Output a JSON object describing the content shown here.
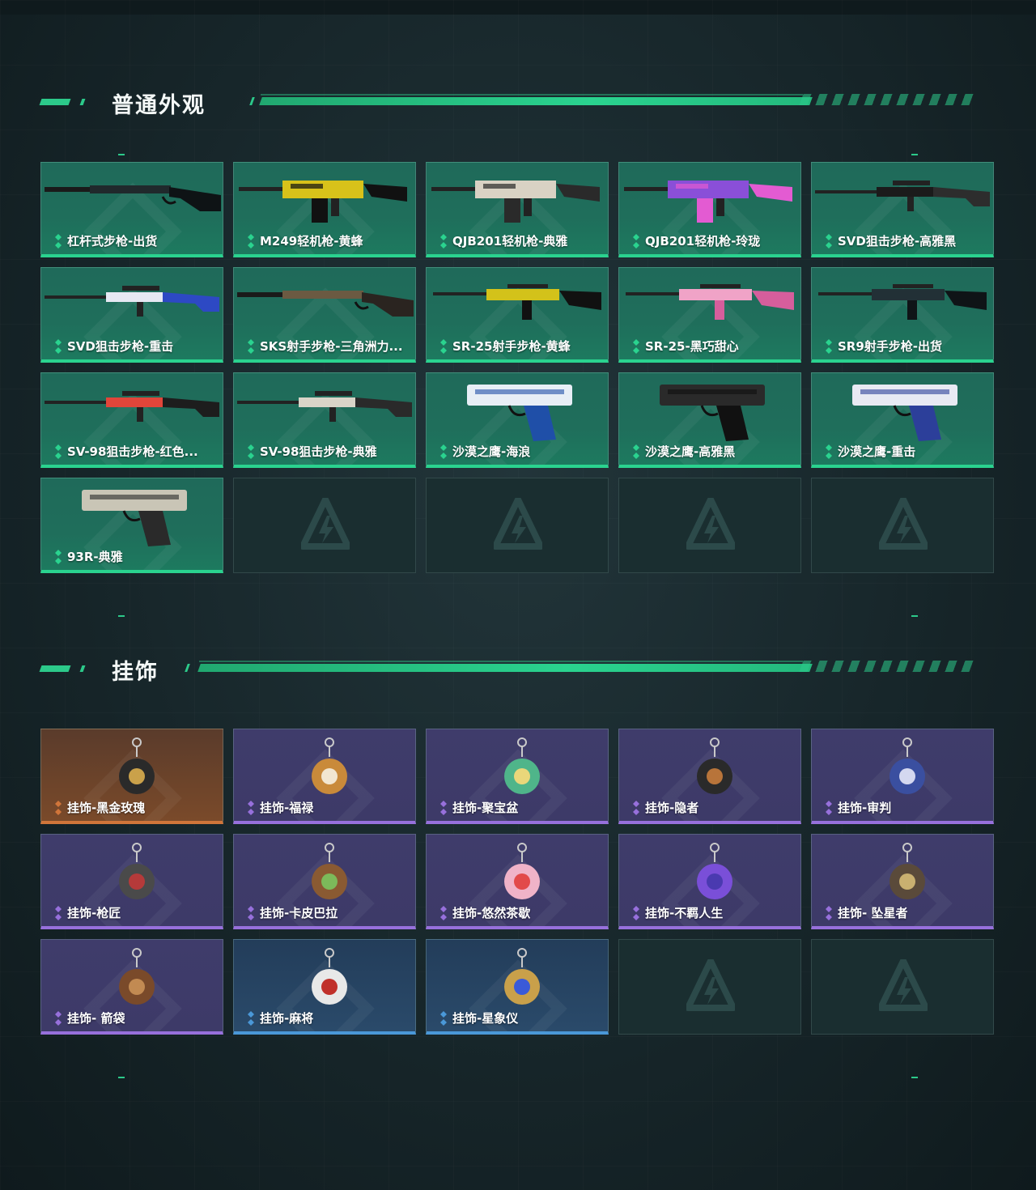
{
  "sections": [
    {
      "title": "普通外观",
      "items": [
        {
          "label": "杠杆式步枪-出货",
          "type": "rifle",
          "palette": [
            "#20292c",
            "#0e1315"
          ]
        },
        {
          "label": "M249轻机枪-黄蜂",
          "type": "lmg",
          "palette": [
            "#d8c21a",
            "#111111"
          ]
        },
        {
          "label": "QJB201轻机枪-典雅",
          "type": "lmg",
          "palette": [
            "#d9d2c4",
            "#2a2a2a"
          ]
        },
        {
          "label": "QJB201轻机枪-玲珑",
          "type": "lmg",
          "palette": [
            "#8a4fd8",
            "#e35bd2"
          ]
        },
        {
          "label": "SVD狙击步枪-高雅黑",
          "type": "sniper",
          "palette": [
            "#1b1b1b",
            "#2d2d2d"
          ]
        },
        {
          "label": "SVD狙击步枪-重击",
          "type": "sniper",
          "palette": [
            "#e6e8f3",
            "#2d49c4"
          ]
        },
        {
          "label": "SKS射手步枪-三角洲力...",
          "type": "rifle",
          "palette": [
            "#6b5a42",
            "#2a2420"
          ]
        },
        {
          "label": "SR-25射手步枪-黄蜂",
          "type": "dmr",
          "palette": [
            "#d3c21a",
            "#111111"
          ]
        },
        {
          "label": "SR-25-黑巧甜心",
          "type": "dmr",
          "palette": [
            "#f0a3c7",
            "#d65e9c"
          ]
        },
        {
          "label": "SR9射手步枪-出货",
          "type": "dmr",
          "palette": [
            "#223036",
            "#0f1417"
          ]
        },
        {
          "label": "SV-98狙击步枪-红色...",
          "type": "sniper",
          "palette": [
            "#e1453a",
            "#1d1d1d"
          ]
        },
        {
          "label": "SV-98狙击步枪-典雅",
          "type": "sniper",
          "palette": [
            "#d9d4c8",
            "#2a2a2a"
          ]
        },
        {
          "label": "沙漠之鹰-海浪",
          "type": "pistol",
          "palette": [
            "#e7eef6",
            "#1f4fa8"
          ]
        },
        {
          "label": "沙漠之鹰-高雅黑",
          "type": "pistol",
          "palette": [
            "#2a2a2a",
            "#111111"
          ]
        },
        {
          "label": "沙漠之鹰-重击",
          "type": "pistol",
          "palette": [
            "#e8eaf3",
            "#2c3f9a"
          ]
        },
        {
          "label": "93R-典雅",
          "type": "pistol",
          "palette": [
            "#c9c5b6",
            "#2a2a2a"
          ]
        }
      ]
    },
    {
      "title": "挂饰",
      "items": [
        {
          "label": "挂饰-黑金玫瑰",
          "rarity": "orange",
          "palette": [
            "#2a2a2a",
            "#caa14a"
          ]
        },
        {
          "label": "挂饰-福禄",
          "rarity": "purple",
          "palette": [
            "#c98a3a",
            "#f2e6d0"
          ]
        },
        {
          "label": "挂饰-聚宝盆",
          "rarity": "purple",
          "palette": [
            "#4fb58a",
            "#e9d77a"
          ]
        },
        {
          "label": "挂饰-隐者",
          "rarity": "purple",
          "palette": [
            "#2a2a2a",
            "#b8743a"
          ]
        },
        {
          "label": "挂饰-审判",
          "rarity": "purple",
          "palette": [
            "#3a4fa0",
            "#d4d8f0"
          ]
        },
        {
          "label": "挂饰-枪匠",
          "rarity": "purple",
          "palette": [
            "#4a4a4a",
            "#b53a3a"
          ]
        },
        {
          "label": "挂饰-卡皮巴拉",
          "rarity": "purple",
          "palette": [
            "#8a5a32",
            "#7cba5a"
          ]
        },
        {
          "label": "挂饰-悠然茶歇",
          "rarity": "purple",
          "palette": [
            "#f0b3c8",
            "#e24a4a"
          ]
        },
        {
          "label": "挂饰-不羁人生",
          "rarity": "purple",
          "palette": [
            "#7a4fd8",
            "#4a3ab0"
          ]
        },
        {
          "label": "挂饰- 坠星者",
          "rarity": "purple",
          "palette": [
            "#5a4a3a",
            "#c9b070"
          ]
        },
        {
          "label": "挂饰- 箭袋",
          "rarity": "purple",
          "palette": [
            "#7a4a2a",
            "#c28a52"
          ]
        },
        {
          "label": "挂饰-麻将",
          "rarity": "blue",
          "palette": [
            "#e8e8e8",
            "#c0302a"
          ]
        },
        {
          "label": "挂饰-星象仪",
          "rarity": "blue",
          "palette": [
            "#c9a04a",
            "#3a5ad8"
          ]
        }
      ]
    }
  ],
  "colors": {
    "accent": "#2ad38f",
    "rare_purple": "#9770dc",
    "rare_blue": "#4a98d8",
    "rare_orange": "#d0753a"
  }
}
